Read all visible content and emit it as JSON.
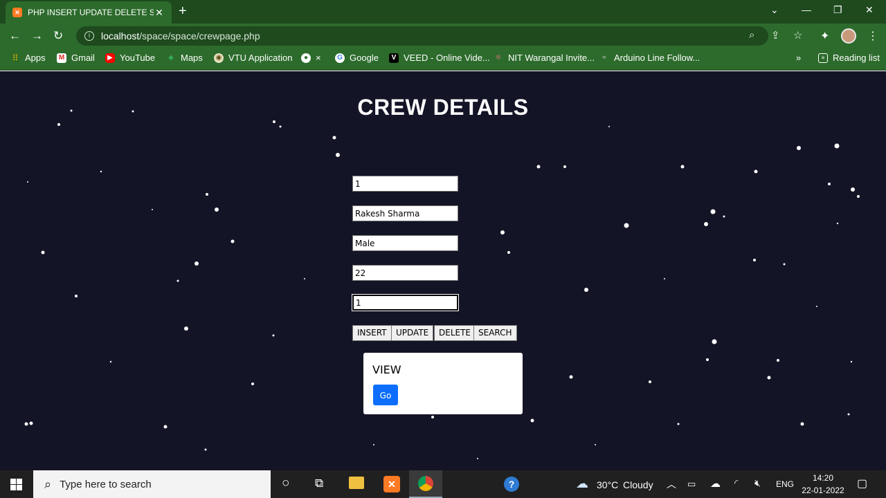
{
  "browser": {
    "tab_title": "PHP INSERT UPDATE DELETE SEA",
    "tab_favicon": "xampp-icon",
    "url_host": "localhost",
    "url_path": "/space/space/crewpage.php",
    "bookmarks": [
      {
        "label": "Apps",
        "icon": "apps-grid-icon"
      },
      {
        "label": "Gmail",
        "icon": "gmail-icon"
      },
      {
        "label": "YouTube",
        "icon": "youtube-icon"
      },
      {
        "label": "Maps",
        "icon": "maps-icon"
      },
      {
        "label": "VTU Application",
        "icon": "vtu-icon"
      },
      {
        "label": "×",
        "icon": "globe-icon"
      },
      {
        "label": "Google",
        "icon": "google-icon"
      },
      {
        "label": "VEED - Online Vide...",
        "icon": "veed-icon"
      },
      {
        "label": "NIT Warangal Invite...",
        "icon": "nitw-icon"
      },
      {
        "label": "Arduino Line Follow...",
        "icon": "arduino-icon"
      }
    ],
    "overflow_label": "»",
    "reading_list": "Reading list"
  },
  "page": {
    "heading": "CREW DETAILS",
    "fields": {
      "crew_id": "1",
      "name": "Rakesh Sharma",
      "gender": "Male",
      "age": "22",
      "last": "1"
    },
    "buttons": {
      "insert": "INSERT",
      "update": "UPDATE",
      "delete": "DELETE",
      "search": "SEARCH"
    },
    "view_card": {
      "title": "VIEW",
      "go_label": "Go"
    },
    "colors": {
      "accent": "#0d6efd",
      "background": "#141427",
      "chrome": "#2c6b2c"
    }
  },
  "taskbar": {
    "search_placeholder": "Type here to search",
    "weather_temp": "30°C",
    "weather_text": "Cloudy",
    "language": "ENG",
    "time": "14:20",
    "date": "22-01-2022"
  }
}
